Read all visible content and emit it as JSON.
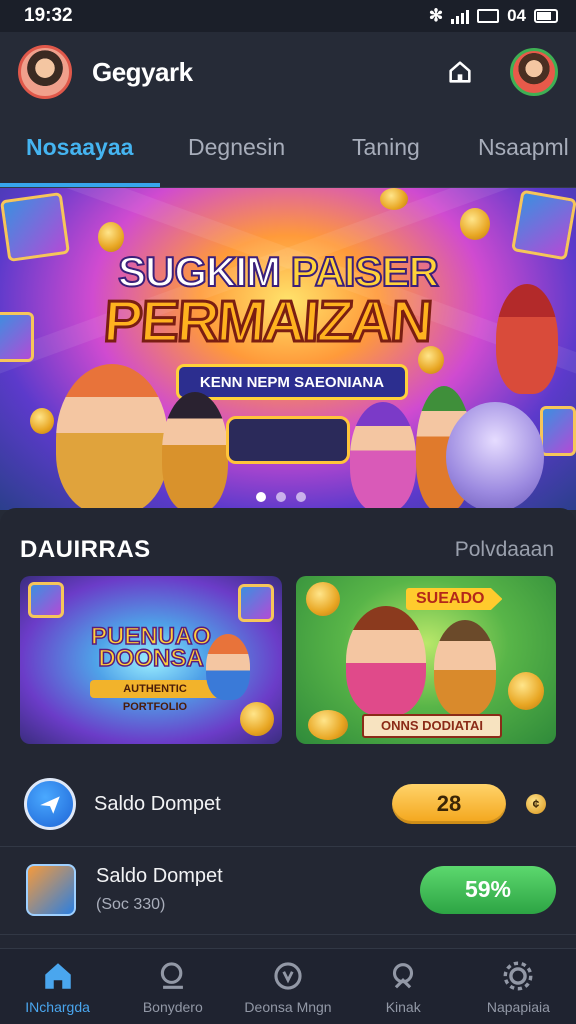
{
  "status_bar": {
    "time": "19:32",
    "battery_text": "04"
  },
  "header": {
    "app_name": "Gegyark"
  },
  "tabs": [
    {
      "label": "Nosaayaa",
      "active": true
    },
    {
      "label": "Degnesin",
      "active": false
    },
    {
      "label": "Taning",
      "active": false
    },
    {
      "label": "Nsaapml",
      "active": false
    }
  ],
  "banner": {
    "title_line1_a": "SUGKIM",
    "title_line1_b": "PAISER",
    "title_line2": "PERMAIZAN",
    "ribbon": "KENN NEPM SAEONIANA",
    "carousel_pages": 3,
    "carousel_active": 1
  },
  "section": {
    "title": "DAUIRRAS",
    "link": "Polvdaaan",
    "cards": [
      {
        "title": "PUENUAO DOONSA",
        "subtitle": "AUTHENTIC PORTFOLIO"
      },
      {
        "tag": "SUEADO",
        "footer": "ONNS DODIATAI"
      }
    ]
  },
  "rows": [
    {
      "label": "Saldo Dompet",
      "value": "28"
    },
    {
      "label": "Saldo Dompet",
      "sub": "(Soc 330)",
      "value": "59%"
    }
  ],
  "bottom_nav": [
    {
      "label": "INchargda",
      "icon": "home-icon",
      "active": true
    },
    {
      "label": "Bonydero",
      "icon": "search-icon",
      "active": false
    },
    {
      "label": "Deonsa Mngn",
      "icon": "compass-icon",
      "active": false
    },
    {
      "label": "Kinak",
      "icon": "trophy-icon",
      "active": false
    },
    {
      "label": "Napapiaia",
      "icon": "settings-icon",
      "active": false
    }
  ],
  "colors": {
    "accent": "#37a6ec",
    "gold": "#f3a51a",
    "green": "#2da444",
    "background": "#252a36"
  }
}
